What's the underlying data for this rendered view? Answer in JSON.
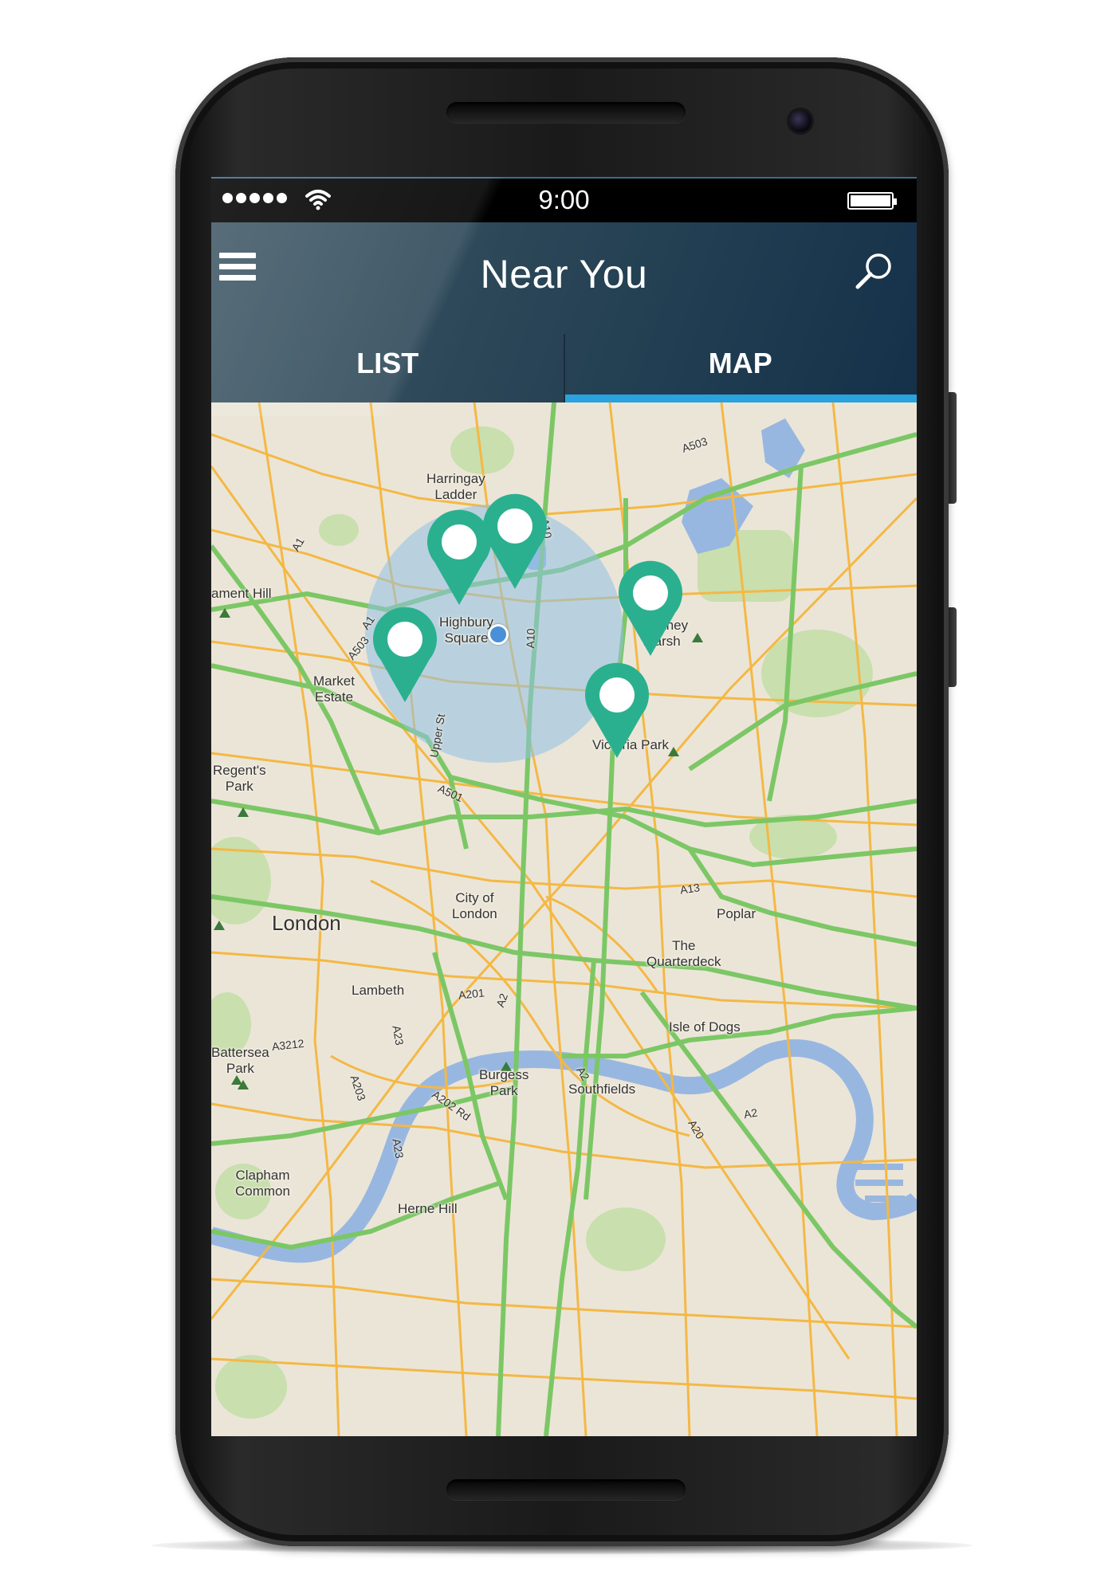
{
  "status_bar": {
    "time": "9:00",
    "signal_icon": "signal-dots-icon",
    "wifi_icon": "wifi-icon",
    "battery_icon": "battery-icon"
  },
  "header": {
    "title": "Near You",
    "menu_icon": "hamburger-menu-icon",
    "search_icon": "search-icon"
  },
  "tabs": [
    {
      "label": "LIST",
      "active": false
    },
    {
      "label": "MAP",
      "active": true
    }
  ],
  "colors": {
    "header_dark": "#15314a",
    "tab_indicator": "#2aa2dd",
    "pin": "#2bb08f",
    "radius_circle": "#8fc1e6",
    "user_dot": "#4a90d9",
    "major_road": "#7cc765",
    "minor_road": "#f4b844",
    "water": "#98b7e0"
  },
  "map": {
    "place_labels": [
      {
        "id": "harringay",
        "text": "Harringay\nLadder"
      },
      {
        "id": "hampstead",
        "text": "ament Hill"
      },
      {
        "id": "highbury",
        "text": "Highbury\nSquare"
      },
      {
        "id": "hackney",
        "text": "Hackney\nMarsh"
      },
      {
        "id": "market",
        "text": "Market\nEstate"
      },
      {
        "id": "victoria",
        "text": "Victoria Park"
      },
      {
        "id": "regents",
        "text": "Regent's\nPark"
      },
      {
        "id": "city",
        "text": "City of\nLondon"
      },
      {
        "id": "london",
        "text": "London"
      },
      {
        "id": "poplar",
        "text": "Poplar"
      },
      {
        "id": "quarterdeck",
        "text": "The\nQuarterdeck"
      },
      {
        "id": "lambeth",
        "text": "Lambeth"
      },
      {
        "id": "isle",
        "text": "Isle of Dogs"
      },
      {
        "id": "battersea",
        "text": "Battersea\nPark"
      },
      {
        "id": "burgess",
        "text": "Burgess\nPark"
      },
      {
        "id": "southfields",
        "text": "Southfields"
      },
      {
        "id": "clapham",
        "text": "Clapham\nCommon"
      },
      {
        "id": "herne",
        "text": "Herne Hill"
      }
    ],
    "road_labels": [
      {
        "id": "a503_top",
        "text": "A503"
      },
      {
        "id": "a10_top",
        "text": "A10"
      },
      {
        "id": "a1",
        "text": "A1"
      },
      {
        "id": "a1b",
        "text": "A1"
      },
      {
        "id": "a503",
        "text": "A503"
      },
      {
        "id": "a10",
        "text": "A10"
      },
      {
        "id": "upper_st",
        "text": "Upper St"
      },
      {
        "id": "a501",
        "text": "A501"
      },
      {
        "id": "a13",
        "text": "A13"
      },
      {
        "id": "a201",
        "text": "A201"
      },
      {
        "id": "a2",
        "text": "A2"
      },
      {
        "id": "a23",
        "text": "A23"
      },
      {
        "id": "a3212",
        "text": "A3212"
      },
      {
        "id": "a203",
        "text": "A203"
      },
      {
        "id": "a202",
        "text": "A202 Rd"
      },
      {
        "id": "a2b",
        "text": "A2"
      },
      {
        "id": "a20",
        "text": "A20"
      },
      {
        "id": "a2c",
        "text": "A2"
      },
      {
        "id": "a23b",
        "text": "A23"
      }
    ],
    "pins": [
      {
        "id": "pin-1",
        "icon": "map-pin-icon"
      },
      {
        "id": "pin-2",
        "icon": "map-pin-icon"
      },
      {
        "id": "pin-3",
        "icon": "map-pin-icon"
      },
      {
        "id": "pin-4",
        "icon": "map-pin-icon"
      },
      {
        "id": "pin-5",
        "icon": "map-pin-icon"
      }
    ]
  }
}
